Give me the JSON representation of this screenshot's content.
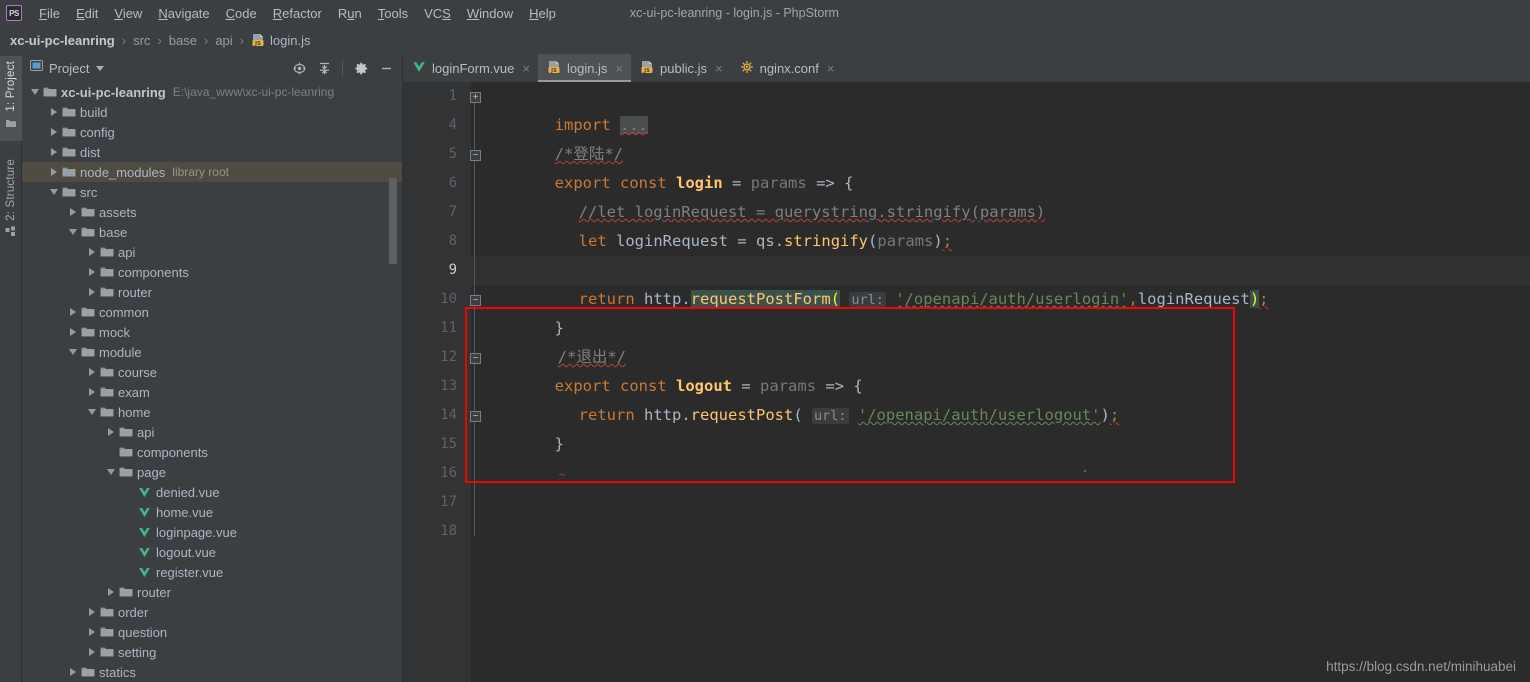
{
  "window": {
    "title": "xc-ui-pc-leanring - login.js - PhpStorm",
    "logo": "PS"
  },
  "menubar": {
    "items": [
      {
        "label": "File",
        "mnemonic": "F"
      },
      {
        "label": "Edit",
        "mnemonic": "E"
      },
      {
        "label": "View",
        "mnemonic": "V"
      },
      {
        "label": "Navigate",
        "mnemonic": "N"
      },
      {
        "label": "Code",
        "mnemonic": "C"
      },
      {
        "label": "Refactor",
        "mnemonic": "R"
      },
      {
        "label": "Run",
        "mnemonic": "u"
      },
      {
        "label": "Tools",
        "mnemonic": "T"
      },
      {
        "label": "VCS",
        "mnemonic": "S"
      },
      {
        "label": "Window",
        "mnemonic": "W"
      },
      {
        "label": "Help",
        "mnemonic": "H"
      }
    ]
  },
  "breadcrumb": {
    "separator": "›",
    "items": [
      {
        "label": "xc-ui-pc-leanring",
        "style": "root"
      },
      {
        "label": "src",
        "style": "dim"
      },
      {
        "label": "base",
        "style": "dim"
      },
      {
        "label": "api",
        "style": "dim"
      },
      {
        "label": "login.js",
        "style": "file",
        "icon": "js-file-icon"
      }
    ]
  },
  "tool_strip": {
    "tabs": [
      {
        "label": "1: Project",
        "icon": "project-icon",
        "active": true
      },
      {
        "label": "2: Structure",
        "icon": "structure-icon",
        "active": false
      }
    ]
  },
  "project_panel": {
    "title": "Project",
    "toolbar_icons": [
      {
        "name": "locate-target-icon"
      },
      {
        "name": "collapse-all-icon"
      },
      {
        "name": "settings-gear-icon"
      },
      {
        "name": "hide-panel-icon"
      }
    ],
    "tree": [
      {
        "label": "xc-ui-pc-leanring",
        "depth": 0,
        "twist": "down",
        "icon": "folder-icon",
        "bold": true,
        "path": "E:\\java_www\\xc-ui-pc-leanring"
      },
      {
        "label": "build",
        "depth": 1,
        "twist": "right",
        "icon": "folder-icon"
      },
      {
        "label": "config",
        "depth": 1,
        "twist": "right",
        "icon": "folder-icon"
      },
      {
        "label": "dist",
        "depth": 1,
        "twist": "right",
        "icon": "folder-icon"
      },
      {
        "label": "node_modules",
        "depth": 1,
        "twist": "right",
        "icon": "folder-icon",
        "note": "library root",
        "highlight": true
      },
      {
        "label": "src",
        "depth": 1,
        "twist": "down",
        "icon": "folder-icon"
      },
      {
        "label": "assets",
        "depth": 2,
        "twist": "right",
        "icon": "folder-icon"
      },
      {
        "label": "base",
        "depth": 2,
        "twist": "down",
        "icon": "folder-icon"
      },
      {
        "label": "api",
        "depth": 3,
        "twist": "right",
        "icon": "folder-icon"
      },
      {
        "label": "components",
        "depth": 3,
        "twist": "right",
        "icon": "folder-icon"
      },
      {
        "label": "router",
        "depth": 3,
        "twist": "right",
        "icon": "folder-icon"
      },
      {
        "label": "common",
        "depth": 2,
        "twist": "right",
        "icon": "folder-icon"
      },
      {
        "label": "mock",
        "depth": 2,
        "twist": "right",
        "icon": "folder-icon"
      },
      {
        "label": "module",
        "depth": 2,
        "twist": "down",
        "icon": "folder-icon"
      },
      {
        "label": "course",
        "depth": 3,
        "twist": "right",
        "icon": "folder-icon"
      },
      {
        "label": "exam",
        "depth": 3,
        "twist": "right",
        "icon": "folder-icon"
      },
      {
        "label": "home",
        "depth": 3,
        "twist": "down",
        "icon": "folder-icon"
      },
      {
        "label": "api",
        "depth": 4,
        "twist": "right",
        "icon": "folder-icon"
      },
      {
        "label": "components",
        "depth": 4,
        "twist": "none",
        "icon": "folder-icon"
      },
      {
        "label": "page",
        "depth": 4,
        "twist": "down",
        "icon": "folder-icon"
      },
      {
        "label": "denied.vue",
        "depth": 5,
        "twist": "none",
        "icon": "vue-file-icon"
      },
      {
        "label": "home.vue",
        "depth": 5,
        "twist": "none",
        "icon": "vue-file-icon"
      },
      {
        "label": "loginpage.vue",
        "depth": 5,
        "twist": "none",
        "icon": "vue-file-icon"
      },
      {
        "label": "logout.vue",
        "depth": 5,
        "twist": "none",
        "icon": "vue-file-icon"
      },
      {
        "label": "register.vue",
        "depth": 5,
        "twist": "none",
        "icon": "vue-file-icon"
      },
      {
        "label": "router",
        "depth": 4,
        "twist": "right",
        "icon": "folder-icon"
      },
      {
        "label": "order",
        "depth": 3,
        "twist": "right",
        "icon": "folder-icon"
      },
      {
        "label": "question",
        "depth": 3,
        "twist": "right",
        "icon": "folder-icon"
      },
      {
        "label": "setting",
        "depth": 3,
        "twist": "right",
        "icon": "folder-icon"
      },
      {
        "label": "statics",
        "depth": 2,
        "twist": "right",
        "icon": "folder-icon"
      }
    ]
  },
  "editor_tabs": [
    {
      "label": "loginForm.vue",
      "icon": "vue-file-icon",
      "active": false,
      "close": "×"
    },
    {
      "label": "login.js",
      "icon": "js-file-icon",
      "active": true,
      "close": "×"
    },
    {
      "label": "public.js",
      "icon": "js-file-icon",
      "active": false,
      "close": "×"
    },
    {
      "label": "nginx.conf",
      "icon": "nginx-file-icon",
      "active": false,
      "close": "×"
    }
  ],
  "editor": {
    "current_line": 9,
    "line_numbers": [
      1,
      4,
      5,
      6,
      7,
      8,
      9,
      10,
      11,
      12,
      13,
      14,
      15,
      16,
      17,
      18
    ],
    "lines": [
      {
        "num": 1,
        "text": "import ...",
        "fold": "plus"
      },
      {
        "num": 4,
        "text": "/*登陆*/"
      },
      {
        "num": 5,
        "text": "export const login = params => {",
        "fold": "minus"
      },
      {
        "num": 6,
        "text": "    //let loginRequest = querystring.stringify(params)"
      },
      {
        "num": 7,
        "text": "    let loginRequest = qs.stringify(params);"
      },
      {
        "num": 8,
        "text": ""
      },
      {
        "num": 9,
        "text": "    return http.requestPostForm( url: '/openapi/auth/userlogin',loginRequest);"
      },
      {
        "num": 10,
        "text": "}",
        "fold": "minus"
      },
      {
        "num": 11,
        "text": "/*退出*/"
      },
      {
        "num": 12,
        "text": "export const logout = params => {",
        "fold": "minus"
      },
      {
        "num": 13,
        "text": "    return http.requestPost( url: '/openapi/auth/userlogout');"
      },
      {
        "num": 14,
        "text": "}",
        "fold": "minus"
      },
      {
        "num": 15,
        "text": "~"
      },
      {
        "num": 16,
        "text": ""
      },
      {
        "num": 17,
        "text": ""
      },
      {
        "num": 18,
        "text": ""
      }
    ],
    "tokens": {
      "import": "import",
      "ellipsis": "...",
      "comment_login": "/*登陆*/",
      "export": "export",
      "const": "const",
      "login_name": "login",
      "logout_name": "logout",
      "params": "params",
      "arrow": "=>",
      "brace_open": "{",
      "brace_close": "}",
      "comment_let": "//let loginRequest = querystring.stringify(params)",
      "let": "let",
      "loginRequest": "loginRequest",
      "eq": "=",
      "qs": "qs",
      "dot": ".",
      "stringify": "stringify",
      "paren_open": "(",
      "paren_close": ")",
      "semi": ";",
      "return": "return",
      "http": "http",
      "requestPostForm": "requestPostForm",
      "requestPost": "requestPost",
      "url_hint": "url:",
      "url_login": "'/openapi/auth/userlogin'",
      "url_logout": "'/openapi/auth/userlogout'",
      "comma": ",",
      "comment_logout": "/*退出*/",
      "tilde": "~"
    },
    "annotation": {
      "name": "red-highlight-box",
      "color": "#f00505"
    }
  },
  "watermark": "https://blog.csdn.net/minihuabei",
  "colors": {
    "bg_chrome": "#3c3f41",
    "bg_editor": "#2b2b2b",
    "bg_gutter": "#313335",
    "accent_keyword": "#cc7832",
    "accent_function": "#ffc66d",
    "accent_string": "#6a8759",
    "accent_comment": "#808080",
    "text_default": "#a9b7c6",
    "annotation_red": "#f00505",
    "library_row": "#4f4b41",
    "tab_active": "#4e5254",
    "vue_green": "#41b883"
  }
}
